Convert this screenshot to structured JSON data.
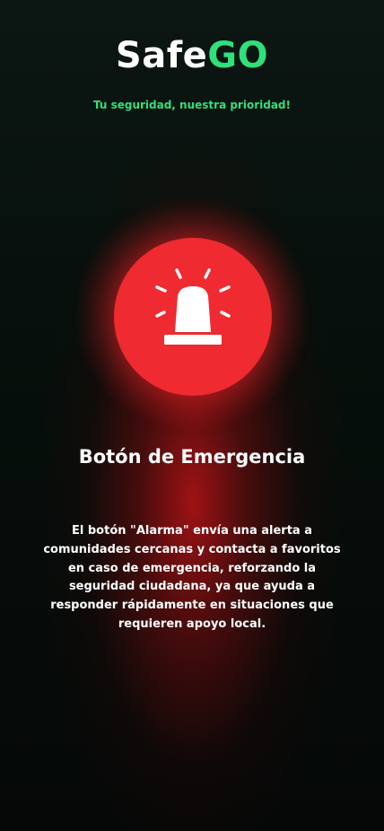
{
  "app": {
    "name_part1": "Safe",
    "name_part2": "GO",
    "tagline": "Tu seguridad, nuestra prioridad!"
  },
  "emergency": {
    "button_icon": "alarm-siren-icon",
    "title": "Botón de Emergencia",
    "description": "El botón \"Alarma\" envía una alerta a comunidades cercanas y contacta a favoritos en caso de emergencia, reforzando la seguridad ciudadana, ya que ayuda a responder rápidamente en situaciones que requieren apoyo local."
  },
  "colors": {
    "brand_green": "#2fe07b",
    "alarm_red": "#ef2a30",
    "background": "#050807"
  }
}
